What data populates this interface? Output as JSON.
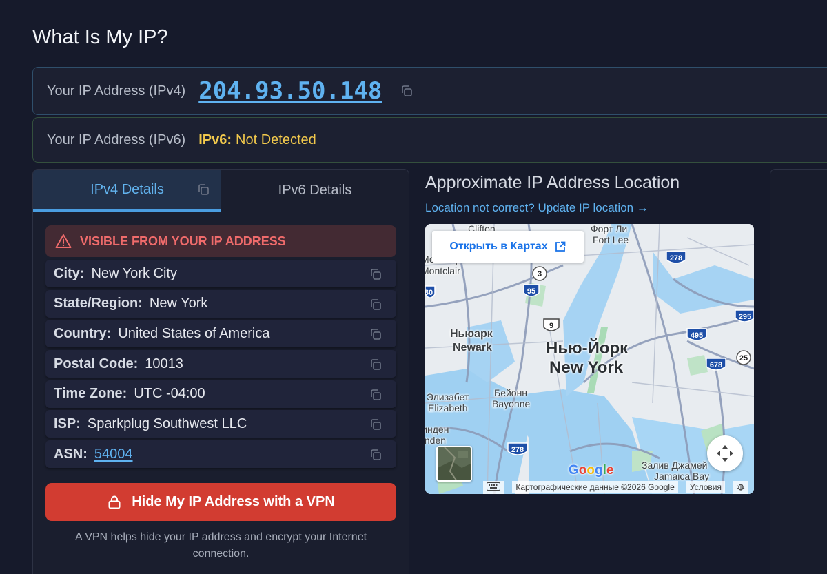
{
  "page_title": "What Is My IP?",
  "ipv4": {
    "label": "Your IP Address (IPv4)",
    "value": "204.93.50.148"
  },
  "ipv6": {
    "label": "Your IP Address (IPv6)",
    "tag": "IPv6:",
    "value": "Not Detected"
  },
  "tabs": [
    {
      "label": "IPv4 Details",
      "active": true
    },
    {
      "label": "IPv6 Details",
      "active": false
    }
  ],
  "warning": "VISIBLE FROM YOUR IP ADDRESS",
  "details": [
    {
      "key": "City:",
      "value": "New York City"
    },
    {
      "key": "State/Region:",
      "value": "New York"
    },
    {
      "key": "Country:",
      "value": "United States of America"
    },
    {
      "key": "Postal Code:",
      "value": "10013"
    },
    {
      "key": "Time Zone:",
      "value": "UTC -04:00"
    },
    {
      "key": "ISP:",
      "value": "Sparkplug Southwest LLC"
    },
    {
      "key": "ASN:",
      "value": "54004"
    }
  ],
  "vpn": {
    "button": "Hide My IP Address with a VPN",
    "note": "A VPN helps hide your IP address and encrypt your Internet connection."
  },
  "location": {
    "title": "Approximate IP Address Location",
    "update_link": "Location not correct? Update IP location →"
  },
  "map": {
    "open_in_maps": "Открыть в Картах",
    "labels": {
      "clifton": "Clifton",
      "fort_lee_ru": "Форт Ли",
      "fort_lee": "Fort Lee",
      "montclair_ru": "Монклер",
      "montclair": "Montclair",
      "newark_ru": "Ньюарк",
      "newark": "Newark",
      "ny_ru": "Нью-Йорк",
      "ny": "New York",
      "elizabeth_ru": "Элизабет",
      "elizabeth": "Elizabeth",
      "bayonne_ru": "Бейонн",
      "bayonne": "Bayonne",
      "linden_ru": "Линден",
      "linden": "Linden",
      "jamaica_ru": "Залив Джамей",
      "jamaica": "Jamaica Bay"
    },
    "shields": [
      "3",
      "95",
      "9",
      "278",
      "295",
      "495",
      "678",
      "25",
      "80",
      "278"
    ],
    "google": "Google",
    "attribution": "Картографические данные ©2026 Google",
    "terms": "Условия"
  },
  "colors": {
    "background": "#161a2b",
    "accent_blue": "#5fb2f0",
    "warning_red": "#ef6b6b",
    "vpn_red": "#d23c31",
    "ipv6_yellow": "#f2c94c"
  }
}
